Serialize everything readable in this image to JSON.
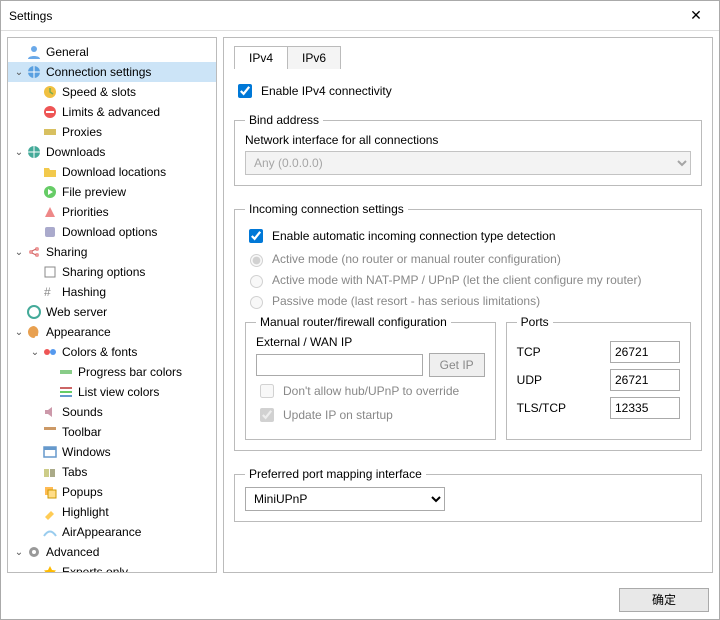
{
  "window": {
    "title": "Settings"
  },
  "tree": [
    {
      "label": "General",
      "depth": 0,
      "twist": "",
      "icon": "user",
      "sel": false
    },
    {
      "label": "Connection settings",
      "depth": 0,
      "twist": "v",
      "icon": "globe",
      "sel": true
    },
    {
      "label": "Speed & slots",
      "depth": 1,
      "twist": "",
      "icon": "clock",
      "sel": false
    },
    {
      "label": "Limits & advanced",
      "depth": 1,
      "twist": "",
      "icon": "limit",
      "sel": false
    },
    {
      "label": "Proxies",
      "depth": 1,
      "twist": "",
      "icon": "proxy",
      "sel": false
    },
    {
      "label": "Downloads",
      "depth": 0,
      "twist": "v",
      "icon": "globe2",
      "sel": false
    },
    {
      "label": "Download locations",
      "depth": 1,
      "twist": "",
      "icon": "folder",
      "sel": false
    },
    {
      "label": "File preview",
      "depth": 1,
      "twist": "",
      "icon": "play",
      "sel": false
    },
    {
      "label": "Priorities",
      "depth": 1,
      "twist": "",
      "icon": "prio",
      "sel": false
    },
    {
      "label": "Download options",
      "depth": 1,
      "twist": "",
      "icon": "opts",
      "sel": false
    },
    {
      "label": "Sharing",
      "depth": 0,
      "twist": "v",
      "icon": "share",
      "sel": false
    },
    {
      "label": "Sharing options",
      "depth": 1,
      "twist": "",
      "icon": "sopts",
      "sel": false
    },
    {
      "label": "Hashing",
      "depth": 1,
      "twist": "",
      "icon": "hash",
      "sel": false
    },
    {
      "label": "Web server",
      "depth": 0,
      "twist": "",
      "icon": "web",
      "sel": false
    },
    {
      "label": "Appearance",
      "depth": 0,
      "twist": "v",
      "icon": "palette",
      "sel": false
    },
    {
      "label": "Colors & fonts",
      "depth": 1,
      "twist": "v",
      "icon": "colors",
      "sel": false
    },
    {
      "label": "Progress bar colors",
      "depth": 2,
      "twist": "",
      "icon": "prog",
      "sel": false
    },
    {
      "label": "List view colors",
      "depth": 2,
      "twist": "",
      "icon": "list",
      "sel": false
    },
    {
      "label": "Sounds",
      "depth": 1,
      "twist": "",
      "icon": "sound",
      "sel": false
    },
    {
      "label": "Toolbar",
      "depth": 1,
      "twist": "",
      "icon": "tool",
      "sel": false
    },
    {
      "label": "Windows",
      "depth": 1,
      "twist": "",
      "icon": "win",
      "sel": false
    },
    {
      "label": "Tabs",
      "depth": 1,
      "twist": "",
      "icon": "tabs",
      "sel": false
    },
    {
      "label": "Popups",
      "depth": 1,
      "twist": "",
      "icon": "popup",
      "sel": false
    },
    {
      "label": "Highlight",
      "depth": 1,
      "twist": "",
      "icon": "hl",
      "sel": false
    },
    {
      "label": "AirAppearance",
      "depth": 1,
      "twist": "",
      "icon": "air",
      "sel": false
    },
    {
      "label": "Advanced",
      "depth": 0,
      "twist": "v",
      "icon": "gear",
      "sel": false
    },
    {
      "label": "Experts only",
      "depth": 1,
      "twist": "",
      "icon": "expert",
      "sel": false
    }
  ],
  "tabs": {
    "ipv4": "IPv4",
    "ipv6": "IPv6"
  },
  "main": {
    "enable_ipv4": "Enable IPv4 connectivity",
    "bind_group": "Bind address",
    "bind_label": "Network interface for all connections",
    "bind_value": "Any (0.0.0.0)",
    "incoming_group": "Incoming connection settings",
    "auto_detect": "Enable automatic incoming connection type detection",
    "radio_active": "Active mode (no router or manual router configuration)",
    "radio_nat": "Active mode with NAT-PMP / UPnP (let the client configure my router)",
    "radio_passive": "Passive mode (last resort - has serious limitations)",
    "manual_group": "Manual router/firewall configuration",
    "ext_ip_label": "External / WAN IP",
    "get_ip_btn": "Get IP",
    "no_override": "Don't allow hub/UPnP to override",
    "update_startup": "Update IP on startup",
    "ports_group": "Ports",
    "tcp_label": "TCP",
    "tcp_value": "26721",
    "udp_label": "UDP",
    "udp_value": "26721",
    "tls_label": "TLS/TCP",
    "tls_value": "12335",
    "pref_group": "Preferred port mapping interface",
    "pref_value": "MiniUPnP"
  },
  "footer": {
    "ok": "确定"
  }
}
